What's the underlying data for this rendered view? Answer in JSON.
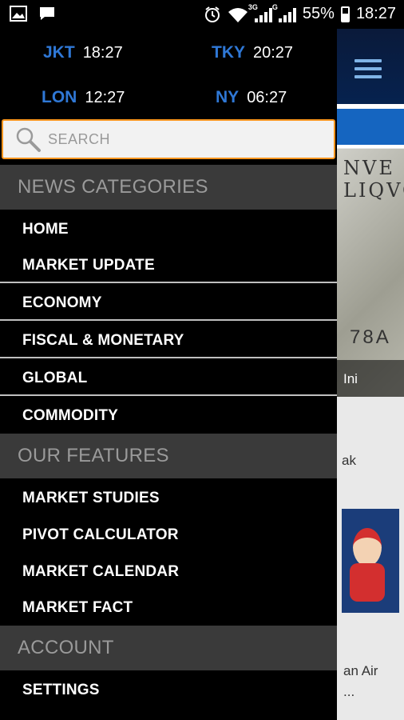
{
  "status_bar": {
    "left_icons": [
      "image-icon",
      "chat-icon"
    ],
    "network_1": "3G",
    "network_2": "G",
    "battery": "55%",
    "time": "18:27"
  },
  "world_clocks": [
    {
      "city": "JKT",
      "time": "18:27"
    },
    {
      "city": "TKY",
      "time": "20:27"
    },
    {
      "city": "LON",
      "time": "12:27"
    },
    {
      "city": "NY",
      "time": "06:27"
    }
  ],
  "search": {
    "placeholder": "SEARCH"
  },
  "sections": {
    "news_categories": {
      "title": "NEWS CATEGORIES",
      "items": [
        "HOME",
        "MARKET UPDATE",
        "ECONOMY",
        "FISCAL & MONETARY",
        "GLOBAL",
        "COMMODITY"
      ]
    },
    "our_features": {
      "title": "OUR FEATURES",
      "items": [
        "MARKET STUDIES",
        "PIVOT CALCULATOR",
        "MARKET CALENDAR",
        "MARKET FACT"
      ]
    },
    "account": {
      "title": "ACCOUNT",
      "items": [
        "SETTINGS"
      ]
    }
  },
  "background": {
    "caption": "Ini",
    "snippet_1": "ak",
    "snippet_2a": "an Air",
    "snippet_2b": "..."
  },
  "colors": {
    "accent_blue": "#2f78d6",
    "search_border": "#f7941d",
    "section_bg": "#3a3a3a"
  }
}
